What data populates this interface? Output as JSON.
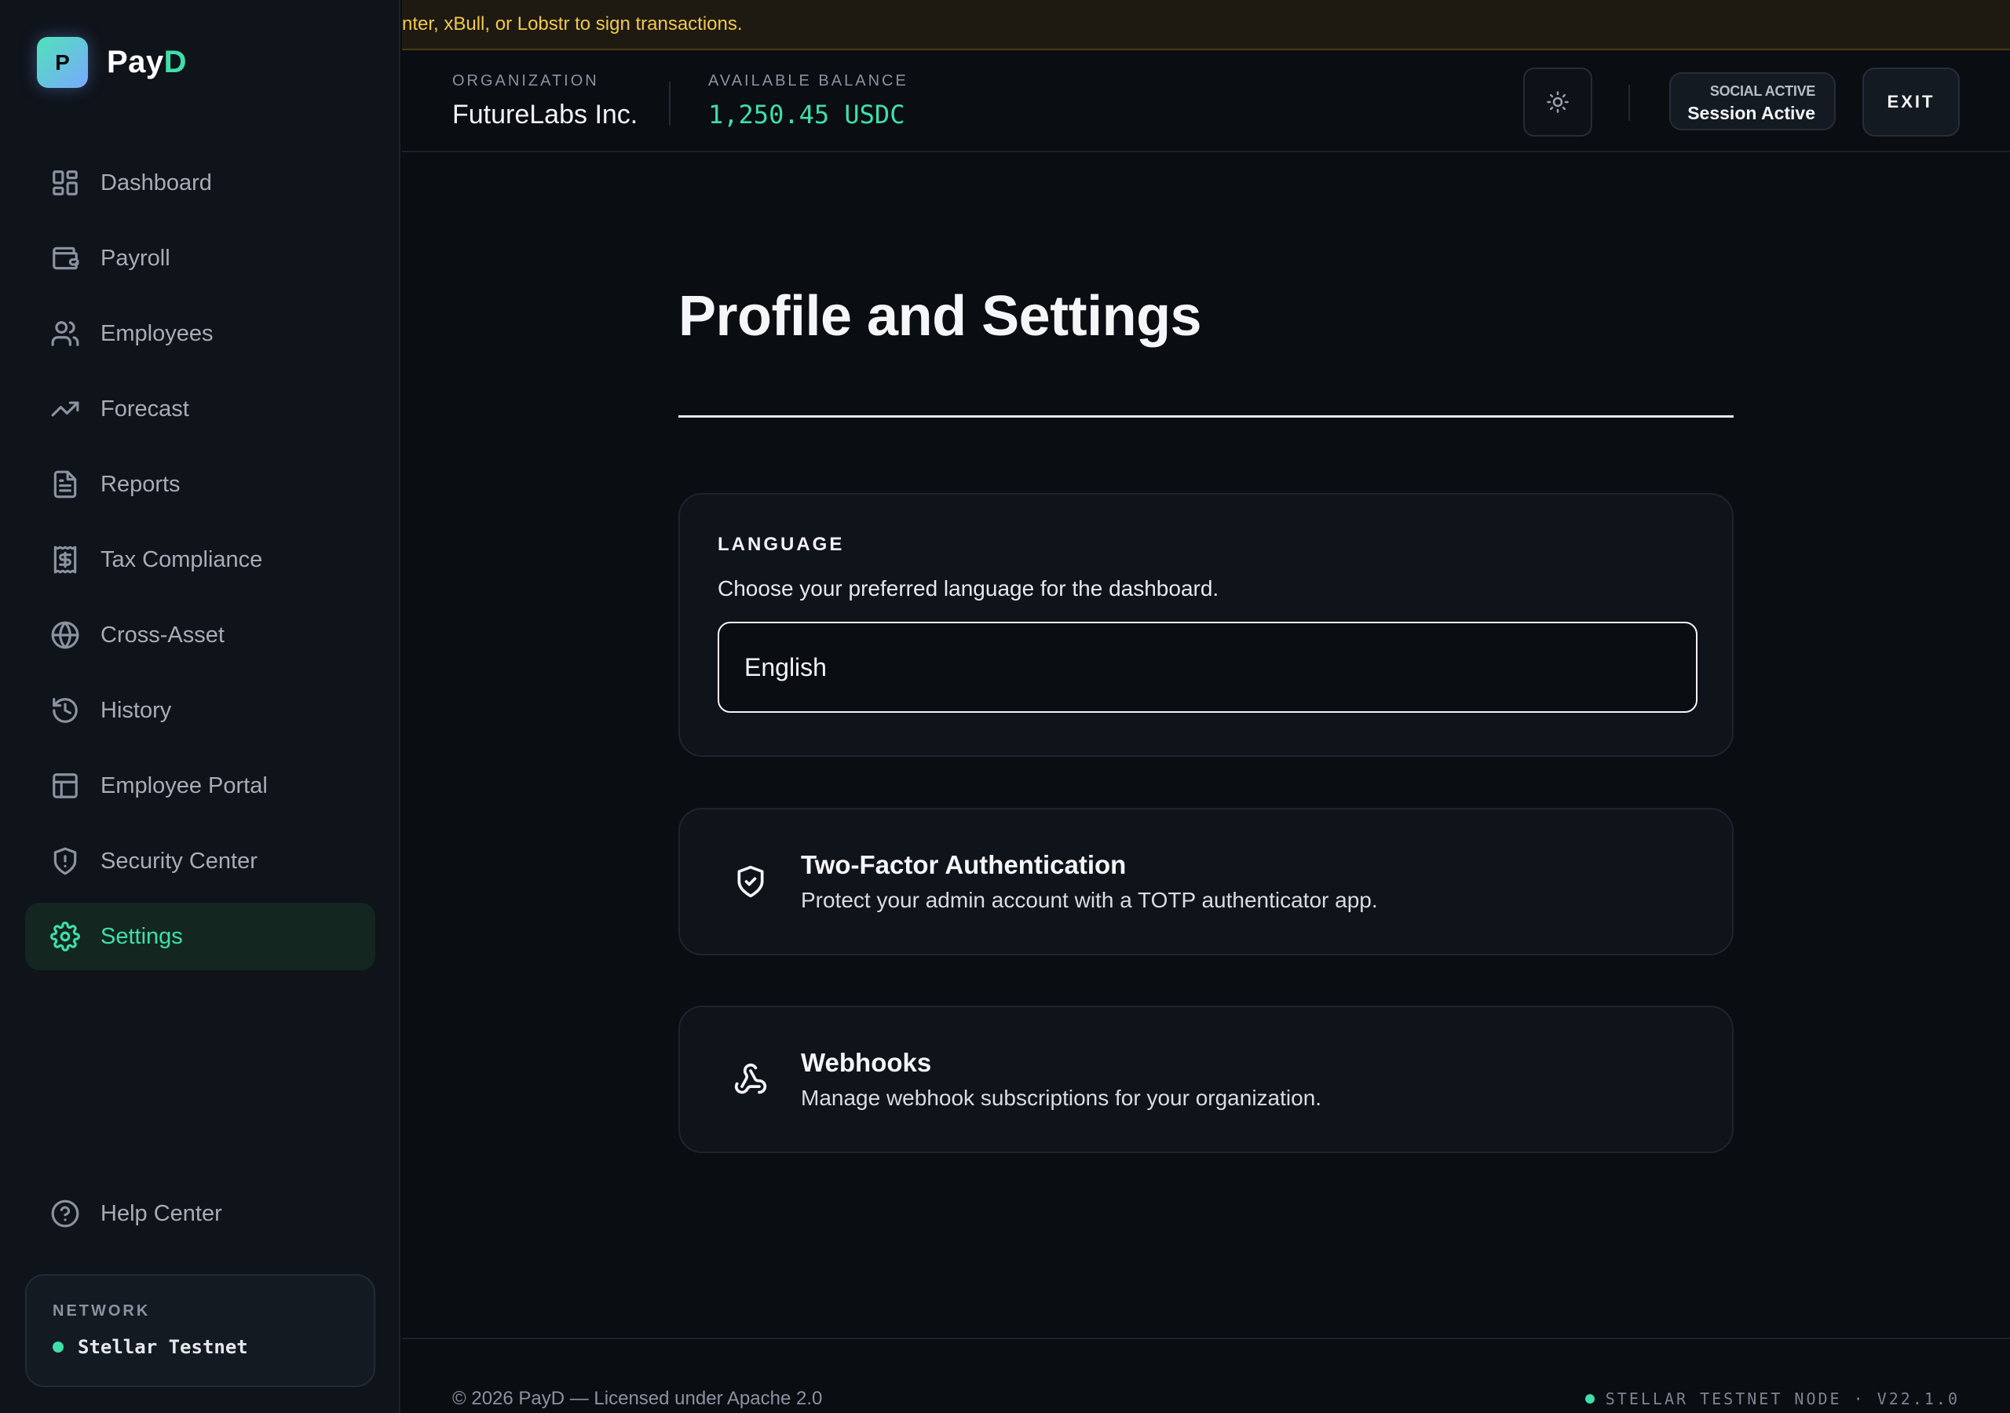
{
  "brand": {
    "mark": "P",
    "name_main": "Pay",
    "name_accent": "D",
    "accent_color": "#3ee0a8"
  },
  "banner": {
    "text": "nter, xBull, or Lobstr to sign transactions."
  },
  "sidebar": {
    "items": [
      {
        "label": "Dashboard",
        "icon": "dashboard-icon"
      },
      {
        "label": "Payroll",
        "icon": "wallet-icon"
      },
      {
        "label": "Employees",
        "icon": "users-icon"
      },
      {
        "label": "Forecast",
        "icon": "trending-up-icon"
      },
      {
        "label": "Reports",
        "icon": "file-text-icon"
      },
      {
        "label": "Tax Compliance",
        "icon": "receipt-dollar-icon"
      },
      {
        "label": "Cross-Asset",
        "icon": "globe-icon"
      },
      {
        "label": "History",
        "icon": "history-icon"
      },
      {
        "label": "Employee Portal",
        "icon": "layout-icon"
      },
      {
        "label": "Security Center",
        "icon": "shield-alert-icon"
      },
      {
        "label": "Settings",
        "icon": "gear-icon",
        "active": true
      }
    ],
    "help": {
      "label": "Help Center",
      "icon": "help-circle-icon"
    },
    "network": {
      "label": "NETWORK",
      "value": "Stellar Testnet",
      "status_color": "#3ee0a8"
    }
  },
  "header": {
    "org_caption": "ORGANIZATION",
    "org_name": "FutureLabs Inc.",
    "balance_caption": "AVAILABLE BALANCE",
    "balance_value": "1,250.45 USDC",
    "theme_toggle_icon": "sun-icon",
    "session_caption": "SOCIAL ACTIVE",
    "session_value": "Session Active",
    "exit_label": "EXIT"
  },
  "main": {
    "title": "Profile and Settings",
    "language": {
      "title": "LANGUAGE",
      "description": "Choose your preferred language for the dashboard.",
      "selected": "English"
    },
    "two_factor": {
      "icon": "shield-check-icon",
      "title": "Two-Factor Authentication",
      "description": "Protect your admin account with a TOTP authenticator app."
    },
    "webhooks": {
      "icon": "webhook-icon",
      "title": "Webhooks",
      "description": "Manage webhook subscriptions for your organization."
    }
  },
  "footer": {
    "copyright": "© 2026 PayD — Licensed under Apache 2.0",
    "node_status": "STELLAR TESTNET NODE · V22.1.0"
  }
}
